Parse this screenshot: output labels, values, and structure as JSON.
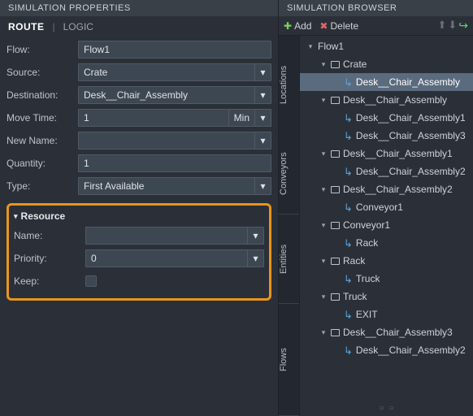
{
  "left": {
    "header": "SIMULATION PROPERTIES",
    "tabs": {
      "route": "ROUTE",
      "logic": "LOGIC"
    },
    "fields": {
      "flow_label": "Flow:",
      "flow_value": "Flow1",
      "source_label": "Source:",
      "source_value": "Crate",
      "dest_label": "Destination:",
      "dest_value": "Desk__Chair_Assembly",
      "movetime_label": "Move Time:",
      "movetime_value": "1",
      "movetime_unit": "Min",
      "newname_label": "New Name:",
      "newname_value": "",
      "quantity_label": "Quantity:",
      "quantity_value": "1",
      "type_label": "Type:",
      "type_value": "First Available"
    },
    "resource": {
      "header": "Resource",
      "name_label": "Name:",
      "name_value": "",
      "priority_label": "Priority:",
      "priority_value": "0",
      "keep_label": "Keep:"
    }
  },
  "right": {
    "header": "SIMULATION BROWSER",
    "toolbar": {
      "add": "Add",
      "delete": "Delete"
    },
    "side_tabs": {
      "locations": "Locations",
      "conveyors": "Conveyors",
      "entities": "Entities",
      "flows": "Flows"
    },
    "tree": [
      {
        "depth": 0,
        "expander": "down",
        "icon": "none",
        "label": "Flow1",
        "selected": false
      },
      {
        "depth": 1,
        "expander": "down",
        "icon": "box",
        "label": "Crate",
        "selected": false
      },
      {
        "depth": 2,
        "expander": "none",
        "icon": "arrow",
        "label": "Desk__Chair_Assembly",
        "selected": true
      },
      {
        "depth": 1,
        "expander": "down",
        "icon": "box",
        "label": "Desk__Chair_Assembly",
        "selected": false
      },
      {
        "depth": 2,
        "expander": "none",
        "icon": "arrow",
        "label": "Desk__Chair_Assembly1",
        "selected": false
      },
      {
        "depth": 2,
        "expander": "none",
        "icon": "arrow",
        "label": "Desk__Chair_Assembly3",
        "selected": false
      },
      {
        "depth": 1,
        "expander": "down",
        "icon": "box",
        "label": "Desk__Chair_Assembly1",
        "selected": false
      },
      {
        "depth": 2,
        "expander": "none",
        "icon": "arrow",
        "label": "Desk__Chair_Assembly2",
        "selected": false
      },
      {
        "depth": 1,
        "expander": "down",
        "icon": "box",
        "label": "Desk__Chair_Assembly2",
        "selected": false
      },
      {
        "depth": 2,
        "expander": "none",
        "icon": "arrow",
        "label": "Conveyor1",
        "selected": false
      },
      {
        "depth": 1,
        "expander": "down",
        "icon": "box",
        "label": "Conveyor1",
        "selected": false
      },
      {
        "depth": 2,
        "expander": "none",
        "icon": "arrow",
        "label": "Rack",
        "selected": false
      },
      {
        "depth": 1,
        "expander": "down",
        "icon": "box",
        "label": "Rack",
        "selected": false
      },
      {
        "depth": 2,
        "expander": "none",
        "icon": "arrow",
        "label": "Truck",
        "selected": false
      },
      {
        "depth": 1,
        "expander": "down",
        "icon": "box",
        "label": "Truck",
        "selected": false
      },
      {
        "depth": 2,
        "expander": "none",
        "icon": "arrow",
        "label": "EXIT",
        "selected": false
      },
      {
        "depth": 1,
        "expander": "down",
        "icon": "box",
        "label": "Desk__Chair_Assembly3",
        "selected": false
      },
      {
        "depth": 2,
        "expander": "none",
        "icon": "arrow",
        "label": "Desk__Chair_Assembly2",
        "selected": false
      }
    ]
  }
}
